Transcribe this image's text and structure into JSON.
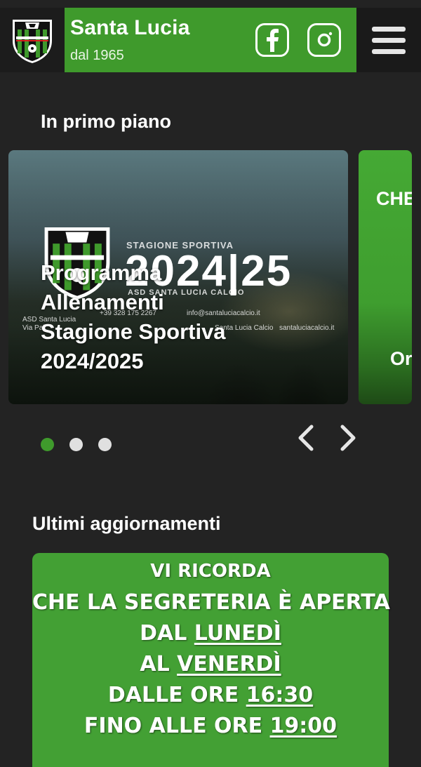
{
  "header": {
    "logo_text": "ASD SANTA LUCIA CALCIO",
    "title": "Santa Lucia",
    "subtitle": "dal 1965",
    "social": [
      {
        "name": "facebook",
        "icon": "facebook-icon"
      },
      {
        "name": "instagram",
        "icon": "instagram-icon"
      }
    ],
    "menu_icon": "hamburger-menu-icon"
  },
  "featured": {
    "title": "In primo piano",
    "slides": [
      {
        "caption_lines": [
          "Programma",
          "Allenamenti",
          "Stagione Sportiva",
          "2024/2025"
        ],
        "poster": {
          "season_label": "STAGIONE SPORTIVA",
          "year": "2024|25",
          "club": "ASD SANTA LUCIA CALCIO",
          "club_small": "ASD Santa Lucia",
          "address": "Via Pal",
          "phone": "+39 328 175 2267",
          "email": "info@santaluciacalcio.it",
          "social": "Santa Lucia Calcio",
          "website": "santaluciacalcio.it"
        }
      },
      {
        "caption_top": "CHE",
        "caption_bottom": "Or"
      }
    ],
    "pagination": {
      "count": 3,
      "active": 0
    },
    "prev_icon": "chevron-left-icon",
    "next_icon": "chevron-right-icon"
  },
  "updates": {
    "title": "Ultimi aggiornamenti",
    "card": {
      "line1": "VI RICORDA",
      "line2": "CHE LA SEGRETERIA È APERTA",
      "line3_prefix": "DAL ",
      "line3_underlined": "LUNEDÌ",
      "line4_prefix": "AL ",
      "line4_underlined": "VENERDÌ",
      "line5_prefix": "DALLE ORE ",
      "line5_underlined": "16:30",
      "line6_prefix": "FINO ALLE ORE ",
      "line6_underlined": "19:00"
    }
  },
  "colors": {
    "background": "#232323",
    "brand_green": "#3f9a2c",
    "card_green": "#43a034",
    "dot_inactive": "#e0e0e0"
  }
}
